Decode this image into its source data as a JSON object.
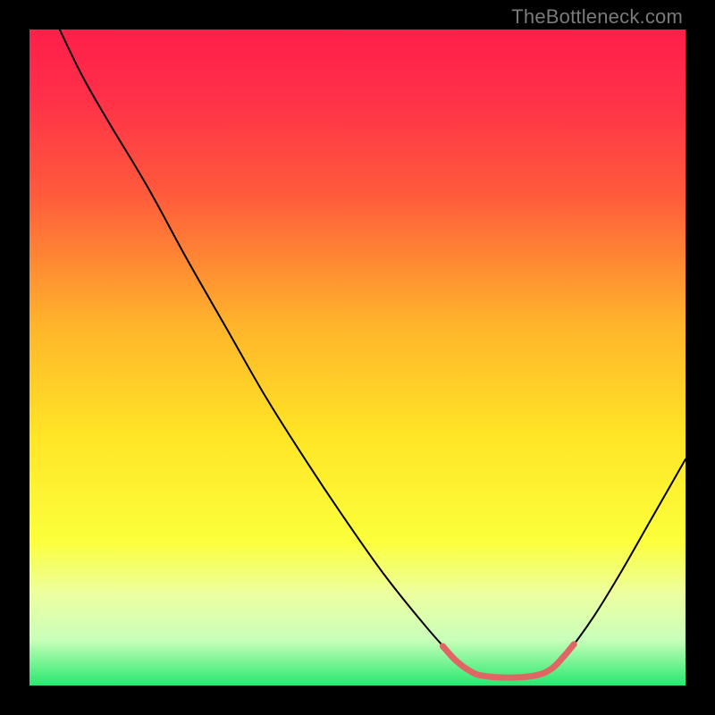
{
  "watermark": "TheBottleneck.com",
  "chart_data": {
    "type": "line",
    "title": "",
    "xlabel": "",
    "ylabel": "",
    "xlim": [
      0,
      100
    ],
    "ylim": [
      0,
      100
    ],
    "gradient_stops": [
      {
        "offset": 0.0,
        "color": "#ff1f4a"
      },
      {
        "offset": 0.1,
        "color": "#ff2f49"
      },
      {
        "offset": 0.25,
        "color": "#ff5a3c"
      },
      {
        "offset": 0.45,
        "color": "#ffb42b"
      },
      {
        "offset": 0.62,
        "color": "#ffe526"
      },
      {
        "offset": 0.78,
        "color": "#fcff3b"
      },
      {
        "offset": 0.86,
        "color": "#edffa0"
      },
      {
        "offset": 0.93,
        "color": "#c9ffba"
      },
      {
        "offset": 1.0,
        "color": "#27e86f"
      }
    ],
    "series": [
      {
        "name": "curve",
        "color": "#000000",
        "stroke_width": 2,
        "points": [
          {
            "x": 4.6,
            "y": 100.0
          },
          {
            "x": 8.0,
            "y": 93.0
          },
          {
            "x": 12.0,
            "y": 86.0
          },
          {
            "x": 18.0,
            "y": 76.0
          },
          {
            "x": 24.0,
            "y": 65.0
          },
          {
            "x": 30.0,
            "y": 54.5
          },
          {
            "x": 36.0,
            "y": 44.0
          },
          {
            "x": 42.0,
            "y": 34.5
          },
          {
            "x": 48.0,
            "y": 25.5
          },
          {
            "x": 54.0,
            "y": 17.0
          },
          {
            "x": 60.0,
            "y": 9.5
          },
          {
            "x": 64.0,
            "y": 5.0
          },
          {
            "x": 67.0,
            "y": 2.3
          },
          {
            "x": 69.0,
            "y": 1.5
          },
          {
            "x": 73.0,
            "y": 1.2
          },
          {
            "x": 77.0,
            "y": 1.5
          },
          {
            "x": 79.5,
            "y": 2.5
          },
          {
            "x": 82.0,
            "y": 5.0
          },
          {
            "x": 86.0,
            "y": 10.5
          },
          {
            "x": 90.0,
            "y": 17.0
          },
          {
            "x": 94.0,
            "y": 24.0
          },
          {
            "x": 98.0,
            "y": 31.0
          },
          {
            "x": 100.0,
            "y": 34.5
          }
        ]
      },
      {
        "name": "highlight-flat",
        "color": "#e06666",
        "stroke_width": 7,
        "points": [
          {
            "x": 63.0,
            "y": 6.0
          },
          {
            "x": 65.0,
            "y": 3.8
          },
          {
            "x": 67.0,
            "y": 2.3
          },
          {
            "x": 69.0,
            "y": 1.5
          },
          {
            "x": 73.0,
            "y": 1.2
          },
          {
            "x": 77.0,
            "y": 1.5
          },
          {
            "x": 79.5,
            "y": 2.5
          },
          {
            "x": 81.5,
            "y": 4.5
          },
          {
            "x": 83.0,
            "y": 6.3
          }
        ]
      }
    ]
  }
}
